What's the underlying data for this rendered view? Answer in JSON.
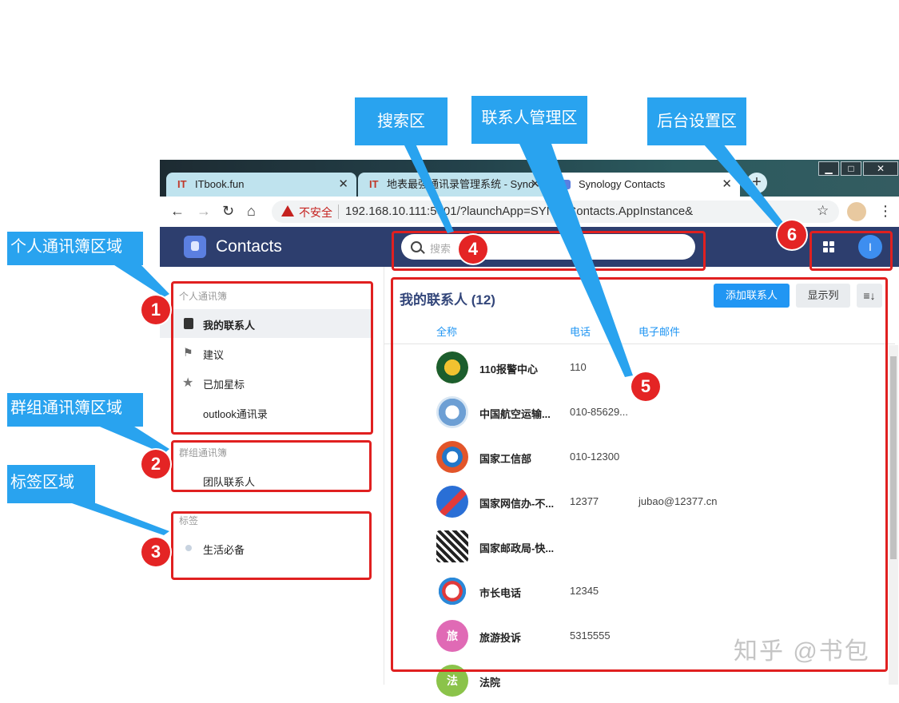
{
  "browser": {
    "tabs": [
      {
        "icon": "IT",
        "label": "ITbook.fun"
      },
      {
        "icon": "IT",
        "label": "地表最强通讯录管理系统 - Syno"
      },
      {
        "icon": "",
        "label": "Synology Contacts"
      }
    ],
    "not_secure": "不安全",
    "url": "192.168.10.111:5001/?launchApp=SYNO.Contacts.AppInstance&"
  },
  "app": {
    "title": "Contacts",
    "search_placeholder": "搜索",
    "avatar_initial": "I"
  },
  "sidebar": {
    "personal_header": "个人通讯簿",
    "personal_items": [
      "我的联系人",
      "建议",
      "已加星标",
      "outlook通讯录"
    ],
    "group_header": "群组通讯簿",
    "group_items": [
      "团队联系人"
    ],
    "labels_header": "标签",
    "label_items": [
      "生活必备"
    ]
  },
  "list": {
    "title": "我的联系人 (12)",
    "add_button": "添加联系人",
    "columns_button": "显示列",
    "headers": {
      "name": "全称",
      "phone": "电话",
      "email": "电子邮件"
    },
    "rows": [
      {
        "name": "110报警中心",
        "phone": "110",
        "email": ""
      },
      {
        "name": "中国航空运输...",
        "phone": "010-85629...",
        "email": ""
      },
      {
        "name": "国家工信部",
        "phone": "010-12300",
        "email": ""
      },
      {
        "name": "国家网信办-不...",
        "phone": "12377",
        "email": "jubao@12377.cn"
      },
      {
        "name": "国家邮政局-快...",
        "phone": "",
        "email": ""
      },
      {
        "name": "市长电话",
        "phone": "12345",
        "email": ""
      },
      {
        "name": "旅游投诉",
        "phone": "5315555",
        "email": "",
        "initial": "旅"
      },
      {
        "name": "法院",
        "phone": "",
        "email": "",
        "initial": "法"
      }
    ]
  },
  "annotations": {
    "callouts": {
      "search": "搜索区",
      "contact_mgmt": "联系人管理区",
      "settings": "后台设置区",
      "personal": "个人通讯簿区域",
      "group": "群组通讯簿区域",
      "labels": "标签区域"
    },
    "numbers": [
      "1",
      "2",
      "3",
      "4",
      "5",
      "6"
    ]
  },
  "watermark": "知乎 @书包",
  "colors": {
    "app_header": "#2d3e6e",
    "accent": "#2196f3",
    "callout": "#29a3ef",
    "annotation_red": "#e02020"
  }
}
